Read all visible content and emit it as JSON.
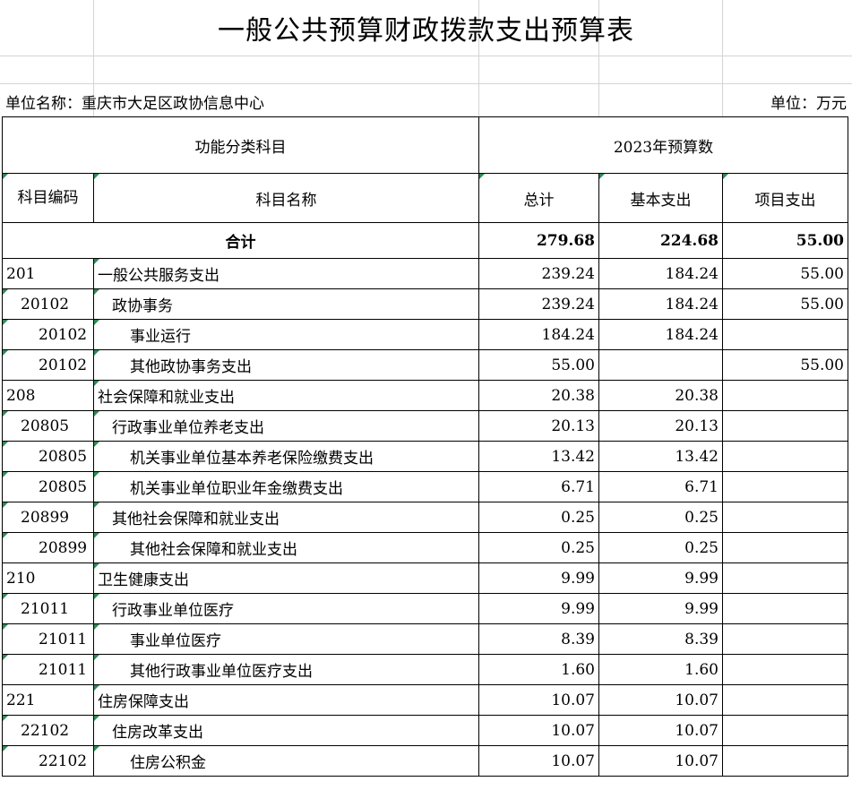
{
  "title": "一般公共预算财政拨款支出预算表",
  "unit_label": "单位名称：重庆市大足区政协信息中心",
  "unit_right": "单位：万元",
  "header": {
    "group_left": "功能分类科目",
    "group_right": "2023年预算数",
    "code": "科目编码",
    "name": "科目名称",
    "total": "总计",
    "basic": "基本支出",
    "project": "项目支出"
  },
  "total_row": {
    "label": "合计",
    "total": "279.68",
    "basic": "224.68",
    "project": "55.00"
  },
  "rows": [
    {
      "code": "201",
      "name": "一般公共服务支出",
      "total": "239.24",
      "basic": "184.24",
      "project": "55.00",
      "level": 1
    },
    {
      "code": "20102",
      "name": "政协事务",
      "total": "239.24",
      "basic": "184.24",
      "project": "55.00",
      "level": 2
    },
    {
      "code": "20102",
      "name": "事业运行",
      "total": "184.24",
      "basic": "184.24",
      "project": "",
      "level": 3
    },
    {
      "code": "20102",
      "name": "其他政协事务支出",
      "total": "55.00",
      "basic": "",
      "project": "55.00",
      "level": 3
    },
    {
      "code": "208",
      "name": "社会保障和就业支出",
      "total": "20.38",
      "basic": "20.38",
      "project": "",
      "level": 1
    },
    {
      "code": "20805",
      "name": "行政事业单位养老支出",
      "total": "20.13",
      "basic": "20.13",
      "project": "",
      "level": 2
    },
    {
      "code": "20805",
      "name": "机关事业单位基本养老保险缴费支出",
      "total": "13.42",
      "basic": "13.42",
      "project": "",
      "level": 3
    },
    {
      "code": "20805",
      "name": "机关事业单位职业年金缴费支出",
      "total": "6.71",
      "basic": "6.71",
      "project": "",
      "level": 3
    },
    {
      "code": "20899",
      "name": "其他社会保障和就业支出",
      "total": "0.25",
      "basic": "0.25",
      "project": "",
      "level": 2
    },
    {
      "code": "20899",
      "name": "其他社会保障和就业支出",
      "total": "0.25",
      "basic": "0.25",
      "project": "",
      "level": 3
    },
    {
      "code": "210",
      "name": "卫生健康支出",
      "total": "9.99",
      "basic": "9.99",
      "project": "",
      "level": 1
    },
    {
      "code": "21011",
      "name": "行政事业单位医疗",
      "total": "9.99",
      "basic": "9.99",
      "project": "",
      "level": 2
    },
    {
      "code": "21011",
      "name": "事业单位医疗",
      "total": "8.39",
      "basic": "8.39",
      "project": "",
      "level": 3
    },
    {
      "code": "21011",
      "name": "其他行政事业单位医疗支出",
      "total": "1.60",
      "basic": "1.60",
      "project": "",
      "level": 3
    },
    {
      "code": "221",
      "name": "住房保障支出",
      "total": "10.07",
      "basic": "10.07",
      "project": "",
      "level": 1
    },
    {
      "code": "22102",
      "name": "住房改革支出",
      "total": "10.07",
      "basic": "10.07",
      "project": "",
      "level": 2
    },
    {
      "code": "22102",
      "name": "住房公积金",
      "total": "10.07",
      "basic": "10.07",
      "project": "",
      "level": 3
    }
  ]
}
